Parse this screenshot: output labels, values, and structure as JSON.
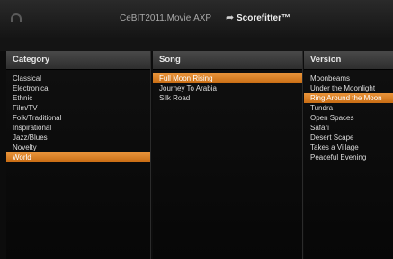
{
  "titlebar": {
    "file_name": "CeBIT2011.Movie.AXP",
    "arrow_glyph": "➦",
    "brand": "Scorefitter™"
  },
  "columns": {
    "category": {
      "header": "Category",
      "items": [
        "Classical",
        "Electronica",
        "Ethnic",
        "Film/TV",
        "Folk/Traditional",
        "Inspirational",
        "Jazz/Blues",
        "Novelty",
        "World"
      ],
      "selected": "World"
    },
    "song": {
      "header": "Song",
      "items": [
        "Full Moon Rising",
        "Journey To Arabia",
        "Silk Road"
      ],
      "selected": "Full Moon Rising"
    },
    "version": {
      "header": "Version",
      "items": [
        "Moonbeams",
        "Under the Moonlight",
        "Ring Around the Moon",
        "Tundra",
        "Open Spaces",
        "Safari",
        "Desert Scape",
        "Takes a Village",
        "Peaceful Evening"
      ],
      "selected": "Ring Around the Moon"
    }
  },
  "colors": {
    "selection": "#d97e22",
    "background": "#0c0c0c",
    "header": "#3a3a3a"
  }
}
